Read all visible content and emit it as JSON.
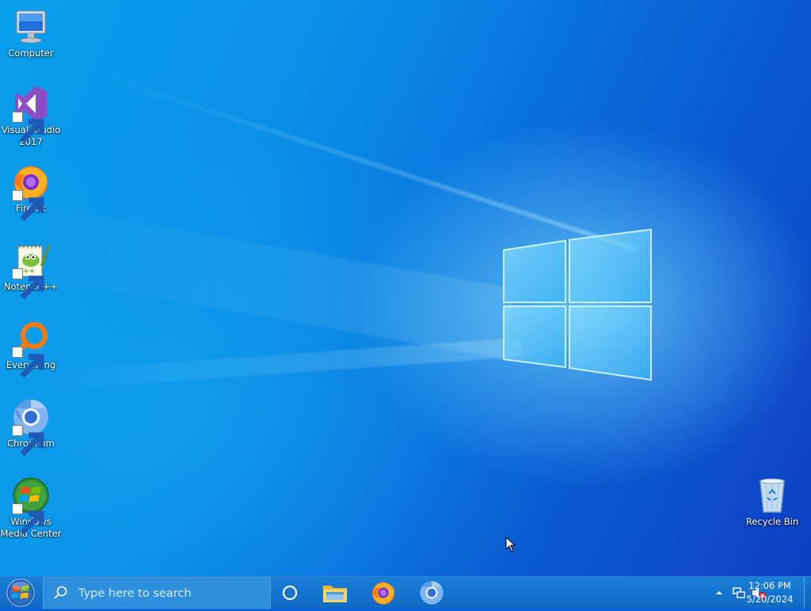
{
  "desktop": {
    "icons": [
      {
        "label": "Computer",
        "icon": "computer-icon"
      },
      {
        "label": "Visual Studio 2017",
        "icon": "visual-studio-icon"
      },
      {
        "label": "Firefox",
        "icon": "firefox-icon"
      },
      {
        "label": "Notepad++",
        "icon": "notepad-plus-plus-icon"
      },
      {
        "label": "Everything",
        "icon": "everything-icon"
      },
      {
        "label": "Chromium",
        "icon": "chromium-icon"
      },
      {
        "label": "Windows Media Center",
        "icon": "windows-media-center-icon"
      },
      {
        "label": "Recycle Bin",
        "icon": "recycle-bin-icon"
      }
    ]
  },
  "taskbar": {
    "search_placeholder": "Type here to search",
    "pinned": [
      {
        "name": "Cortana",
        "icon": "cortana-icon"
      },
      {
        "name": "File Explorer",
        "icon": "file-explorer-icon"
      },
      {
        "name": "Firefox",
        "icon": "firefox-icon"
      },
      {
        "name": "Chromium",
        "icon": "chromium-icon"
      }
    ],
    "clock": {
      "time": "12:06 PM",
      "date": "5/20/2024"
    }
  },
  "colors": {
    "taskbar": "#116ac4",
    "search_box": "#2e8fdc",
    "desktop_accent": "#0a63d6"
  }
}
